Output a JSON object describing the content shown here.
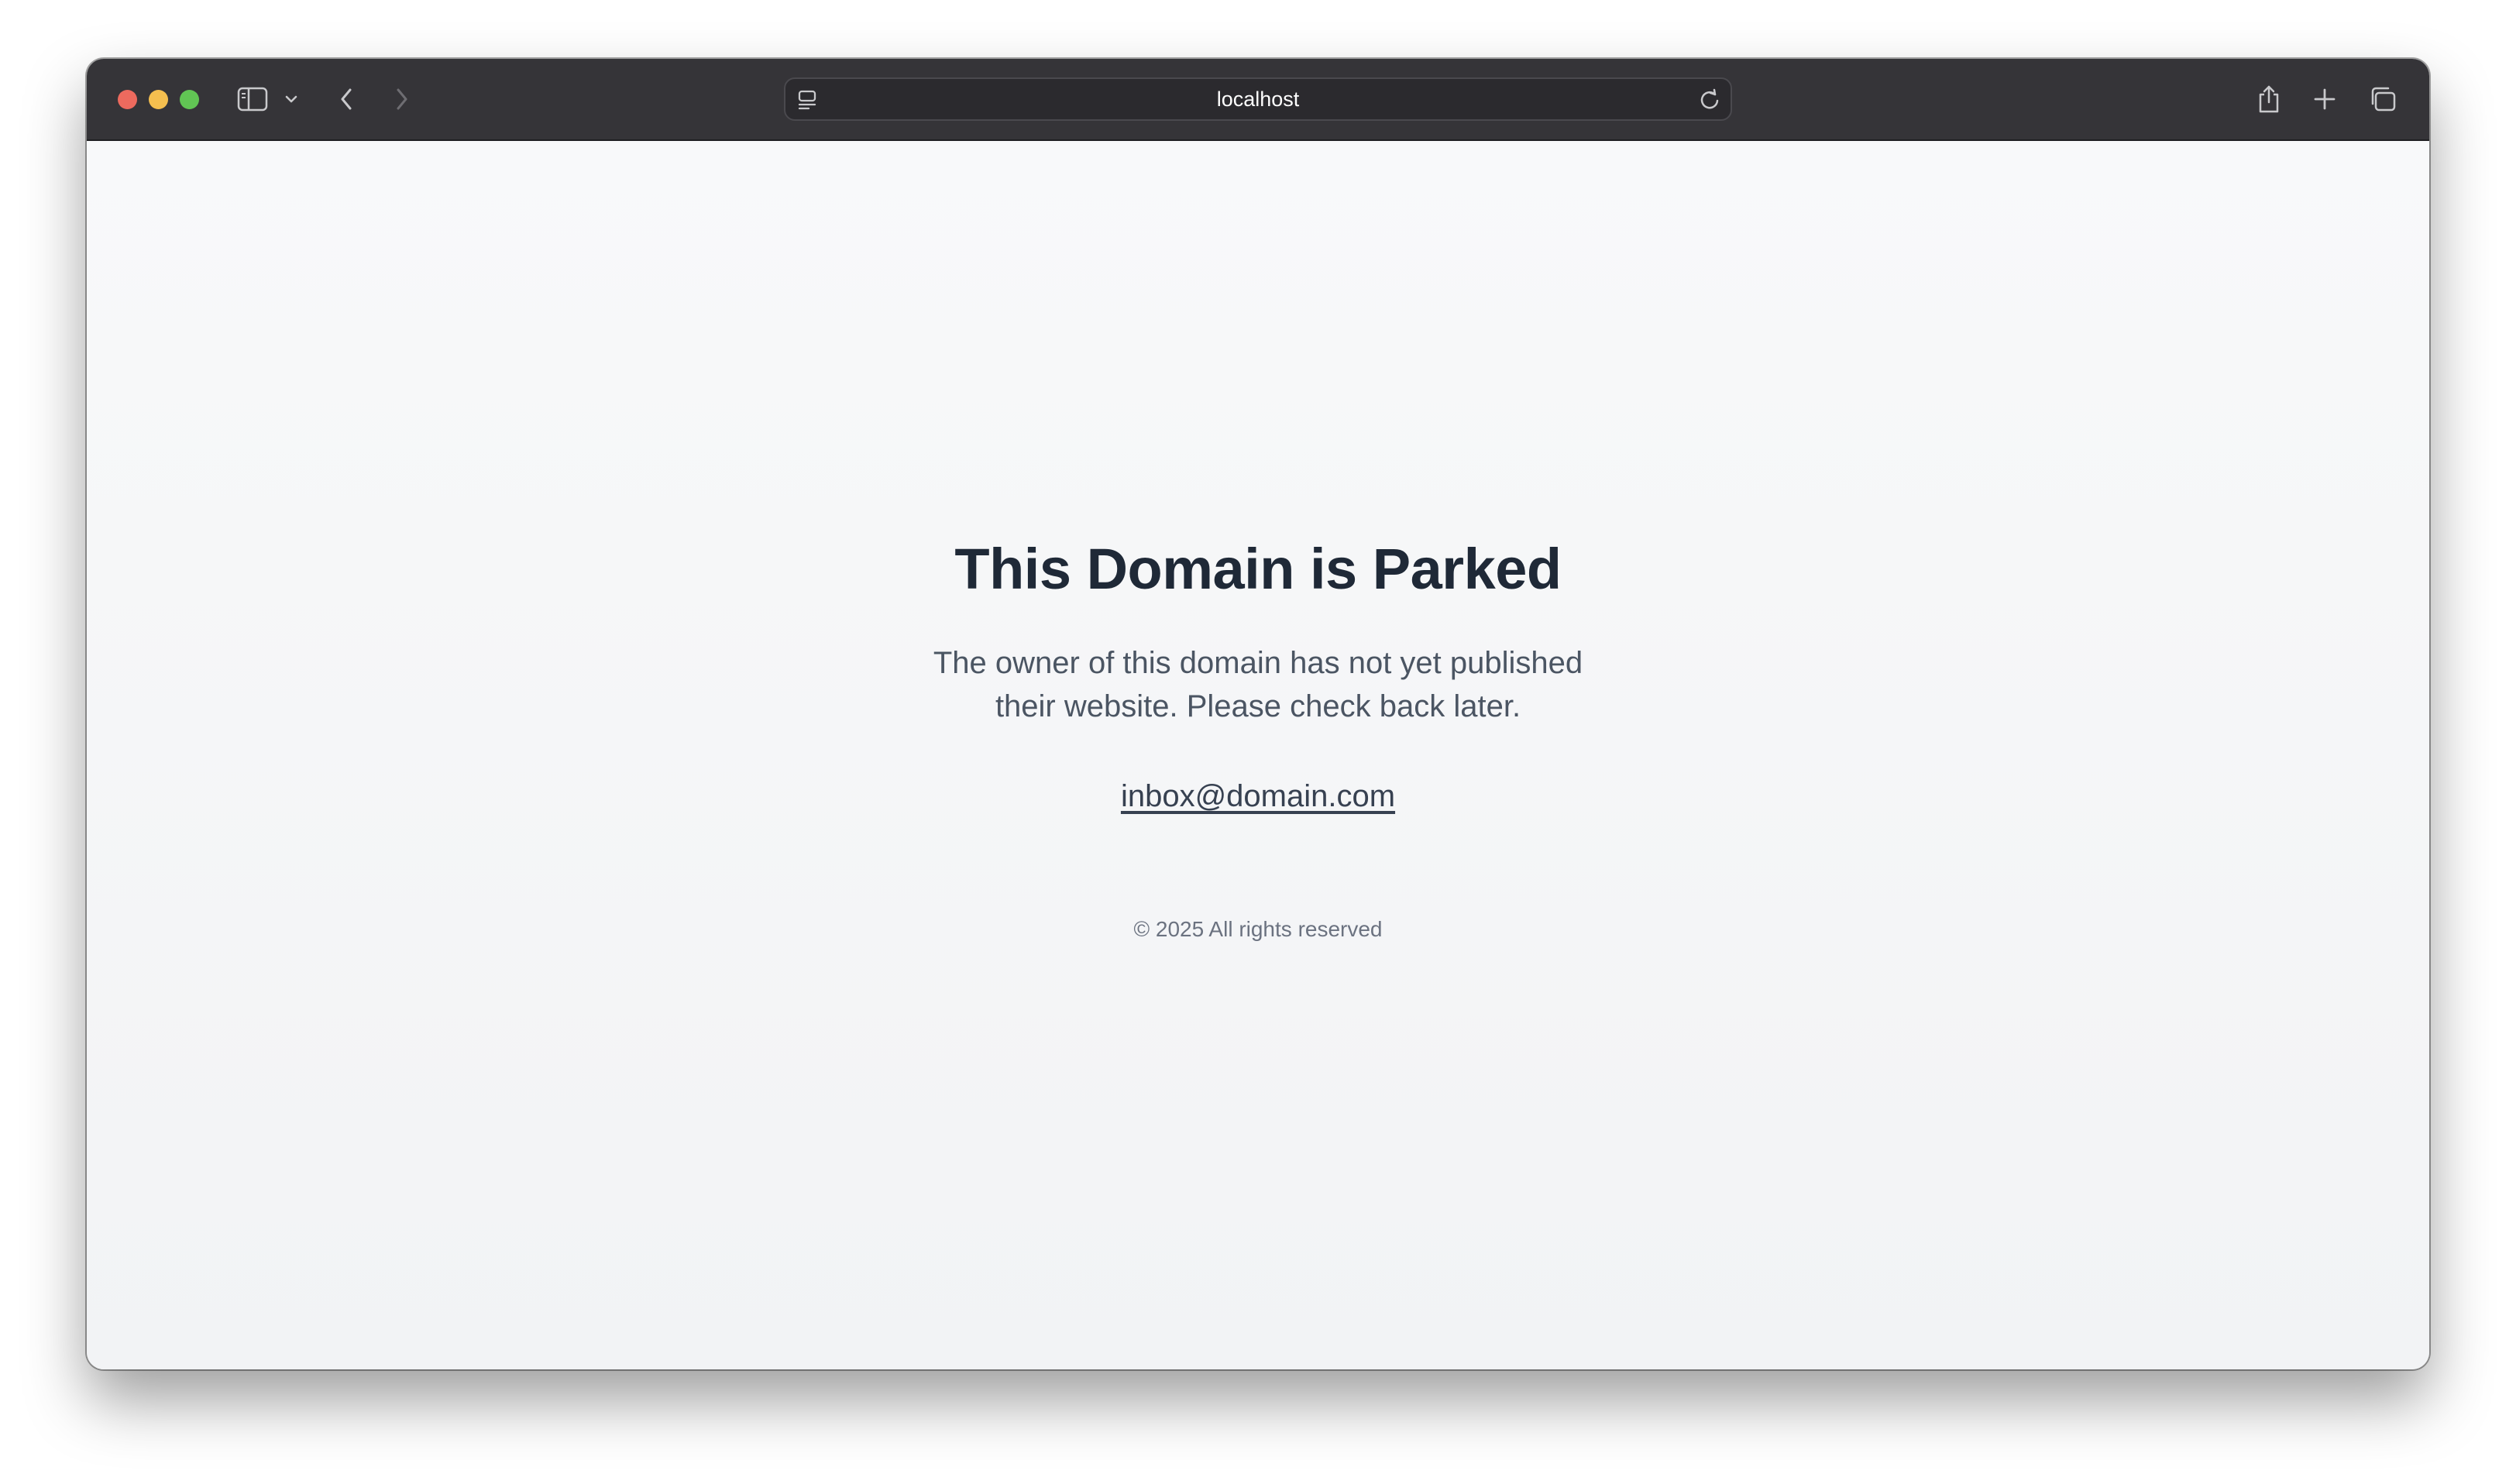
{
  "browser": {
    "address": "localhost",
    "icons": {
      "sidebar": "sidebar-icon",
      "sidebar_menu": "chevron-down-icon",
      "back": "chevron-left-icon",
      "forward": "chevron-right-icon",
      "page_menu": "page-menu-icon",
      "reload": "reload-icon",
      "share": "share-icon",
      "new_tab": "plus-icon",
      "tab_overview": "tabs-icon"
    }
  },
  "page": {
    "headline": "This Domain is Parked",
    "message_line1": "The owner of this domain has not yet published",
    "message_line2": "their website. Please check back later.",
    "contact_email": "inbox@domain.com",
    "footer": "© 2025 All rights reserved"
  },
  "colors": {
    "toolbar": "#353438",
    "heading": "#1f2937",
    "body_text": "#4b5563",
    "background": "#f6f7f9"
  }
}
